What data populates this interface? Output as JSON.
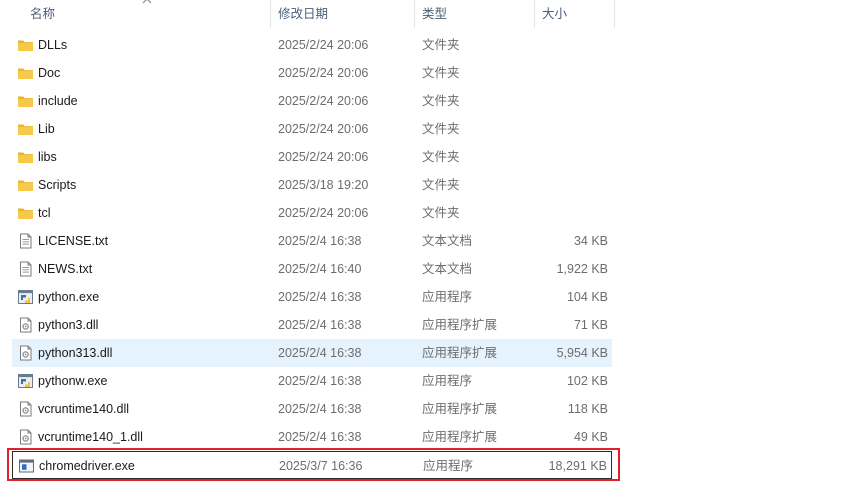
{
  "columns": {
    "name": "名称",
    "date": "修改日期",
    "type": "类型",
    "size": "大小"
  },
  "colors": {
    "folder": "#f7c948",
    "highlight": "#e5f3ff",
    "redbox": "#e0202a"
  },
  "files": [
    {
      "name": "DLLs",
      "date": "2025/2/24 20:06",
      "type": "文件夹",
      "size": "",
      "icon": "folder-icon"
    },
    {
      "name": "Doc",
      "date": "2025/2/24 20:06",
      "type": "文件夹",
      "size": "",
      "icon": "folder-icon"
    },
    {
      "name": "include",
      "date": "2025/2/24 20:06",
      "type": "文件夹",
      "size": "",
      "icon": "folder-icon"
    },
    {
      "name": "Lib",
      "date": "2025/2/24 20:06",
      "type": "文件夹",
      "size": "",
      "icon": "folder-icon"
    },
    {
      "name": "libs",
      "date": "2025/2/24 20:06",
      "type": "文件夹",
      "size": "",
      "icon": "folder-icon"
    },
    {
      "name": "Scripts",
      "date": "2025/3/18 19:20",
      "type": "文件夹",
      "size": "",
      "icon": "folder-icon"
    },
    {
      "name": "tcl",
      "date": "2025/2/24 20:06",
      "type": "文件夹",
      "size": "",
      "icon": "folder-icon"
    },
    {
      "name": "LICENSE.txt",
      "date": "2025/2/4 16:38",
      "type": "文本文档",
      "size": "34 KB",
      "icon": "text-file-icon"
    },
    {
      "name": "NEWS.txt",
      "date": "2025/2/4 16:40",
      "type": "文本文档",
      "size": "1,922 KB",
      "icon": "text-file-icon"
    },
    {
      "name": "python.exe",
      "date": "2025/2/4 16:38",
      "type": "应用程序",
      "size": "104 KB",
      "icon": "python-exe-icon"
    },
    {
      "name": "python3.dll",
      "date": "2025/2/4 16:38",
      "type": "应用程序扩展",
      "size": "71 KB",
      "icon": "dll-file-icon"
    },
    {
      "name": "python313.dll",
      "date": "2025/2/4 16:38",
      "type": "应用程序扩展",
      "size": "5,954 KB",
      "icon": "dll-file-icon"
    },
    {
      "name": "pythonw.exe",
      "date": "2025/2/4 16:38",
      "type": "应用程序",
      "size": "102 KB",
      "icon": "python-exe-icon"
    },
    {
      "name": "vcruntime140.dll",
      "date": "2025/2/4 16:38",
      "type": "应用程序扩展",
      "size": "118 KB",
      "icon": "dll-file-icon"
    },
    {
      "name": "vcruntime140_1.dll",
      "date": "2025/2/4 16:38",
      "type": "应用程序扩展",
      "size": "49 KB",
      "icon": "dll-file-icon"
    },
    {
      "name": "chromedriver.exe",
      "date": "2025/3/7 16:36",
      "type": "应用程序",
      "size": "18,291 KB",
      "icon": "app-window-icon"
    }
  ],
  "hovered_file": "python313.dll",
  "boxed_file": "chromedriver.exe"
}
